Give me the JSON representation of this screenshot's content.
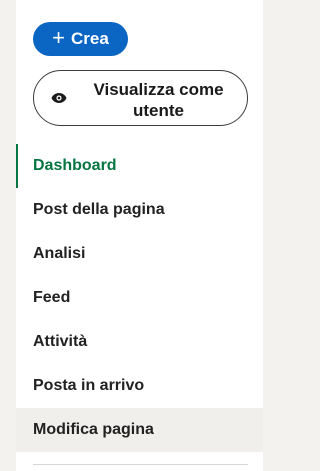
{
  "create_button": {
    "label": "Crea",
    "icon": "plus-icon"
  },
  "view_as_user_button": {
    "label": "Visualizza come utente",
    "icon": "eye-icon"
  },
  "nav": {
    "items": [
      {
        "label": "Dashboard",
        "state": "active"
      },
      {
        "label": "Post della pagina"
      },
      {
        "label": "Analisi"
      },
      {
        "label": "Feed"
      },
      {
        "label": "Attività"
      },
      {
        "label": "Posta in arrivo"
      },
      {
        "label": "Modifica pagina",
        "state": "hovered"
      }
    ]
  },
  "colors": {
    "accent_blue": "#0a66c2",
    "active_green": "#057642",
    "page_background": "#f4f2ee",
    "hover_background": "#f0efec"
  }
}
